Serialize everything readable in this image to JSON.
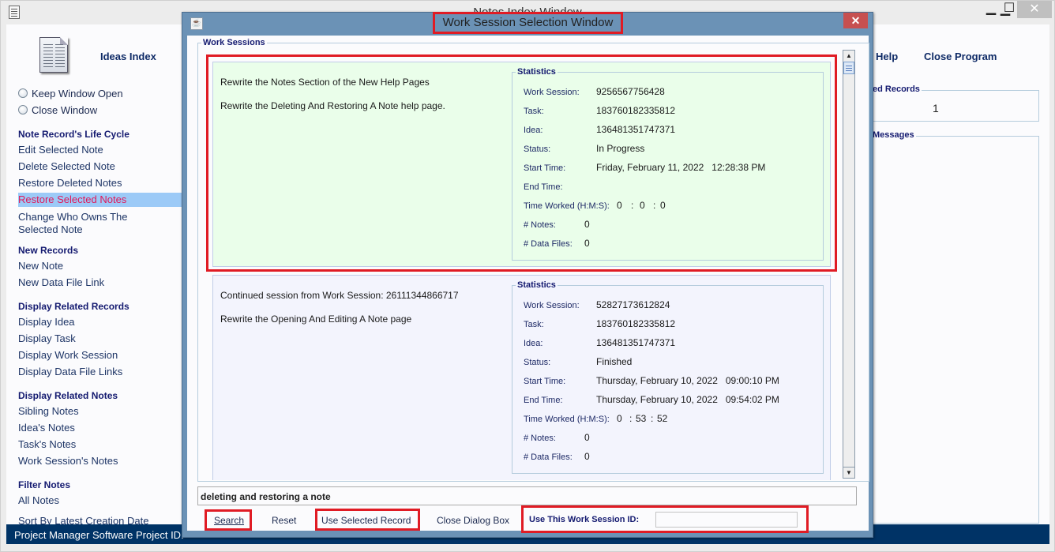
{
  "main_window": {
    "title": "Notes Index Window",
    "controls": {
      "minimize": "▁",
      "maximize": "☐",
      "close": "✕"
    }
  },
  "toolbar": {
    "ideas_index": "Ideas Index",
    "help": "Help",
    "close_program": "Close Program"
  },
  "window_options": [
    {
      "label": "Keep Window Open",
      "selected": false
    },
    {
      "label": "Close Window",
      "selected": false
    }
  ],
  "sidebar": {
    "sections": [
      {
        "heading": "Note Record's Life Cycle",
        "items": [
          "Edit Selected Note",
          "Delete Selected Note",
          "Restore Deleted Notes",
          "Restore Selected Notes",
          "Change Who Owns The",
          "Selected Note"
        ]
      },
      {
        "heading": "New Records",
        "items": [
          "New Note",
          "New Data File Link"
        ]
      },
      {
        "heading": "Display Related Records",
        "items": [
          "Display Idea",
          "Display Task",
          "Display Work Session",
          "Display Data File Links"
        ]
      },
      {
        "heading": "Display Related Notes",
        "items": [
          "Sibling Notes",
          "Idea's Notes",
          "Task's Notes",
          "Work Session's Notes"
        ]
      },
      {
        "heading": "Filter Notes",
        "items": [
          "All Notes",
          "Sort By Latest Creation Date"
        ]
      }
    ],
    "selected_item": "Restore Selected Notes"
  },
  "right_panel": {
    "records_legend": "ed Records",
    "records_count": "1",
    "messages_legend": "Messages"
  },
  "status_bar": {
    "app_name": "Project Manager Software",
    "project_id_label": "Project ID:"
  },
  "dialog": {
    "title": "Work Session Selection Window",
    "close": "✕",
    "group_legend": "Work Sessions",
    "sessions": [
      {
        "lines": [
          "Rewrite the Notes Section of the New Help Pages",
          "Rewrite the Deleting And Restoring A Note help page."
        ],
        "stats_legend": "Statistics",
        "work_session_label": "Work Session:",
        "work_session": "9256567756428",
        "task_label": "Task:",
        "task": "183760182335812",
        "idea_label": "Idea:",
        "idea": "136481351747371",
        "status_label": "Status:",
        "status": "In Progress",
        "start_label": "Start Time:",
        "start": "Friday, February 11, 2022   12:28:38 PM",
        "end_label": "End Time:",
        "end": "",
        "worked_label": "Time Worked (H:M:S):",
        "worked_h": "0",
        "worked_m": "0",
        "worked_s": "0",
        "notes_label": "# Notes:",
        "notes": "0",
        "files_label": "# Data Files:",
        "files": "0",
        "selected": true
      },
      {
        "lines": [
          "Continued session from Work Session: 26111344866717",
          "Rewrite the Opening And Editing A Note page"
        ],
        "stats_legend": "Statistics",
        "work_session_label": "Work Session:",
        "work_session": "52827173612824",
        "task_label": "Task:",
        "task": "183760182335812",
        "idea_label": "Idea:",
        "idea": "136481351747371",
        "status_label": "Status:",
        "status": "Finished",
        "start_label": "Start Time:",
        "start": "Thursday, February 10, 2022   09:00:10 PM",
        "end_label": "End Time:",
        "end": "Thursday, February 10, 2022   09:54:02 PM",
        "worked_label": "Time Worked (H:M:S):",
        "worked_h": "0",
        "worked_m": "53",
        "worked_s": "52",
        "notes_label": "# Notes:",
        "notes": "0",
        "files_label": "# Data Files:",
        "files": "0",
        "selected": false
      }
    ],
    "search_value": "deleting and restoring a note",
    "buttons": {
      "search": "Search",
      "reset": "Reset",
      "use_selected": "Use Selected Record",
      "close_dialog": "Close Dialog Box"
    },
    "ws_id_label": "Use This Work Session ID:",
    "ws_id_value": "",
    "colors": {
      "selected_card": "#eafeea",
      "card": "#f3f4fd",
      "highlight": "#e01b24",
      "title_bar": "#6b92b6"
    }
  }
}
